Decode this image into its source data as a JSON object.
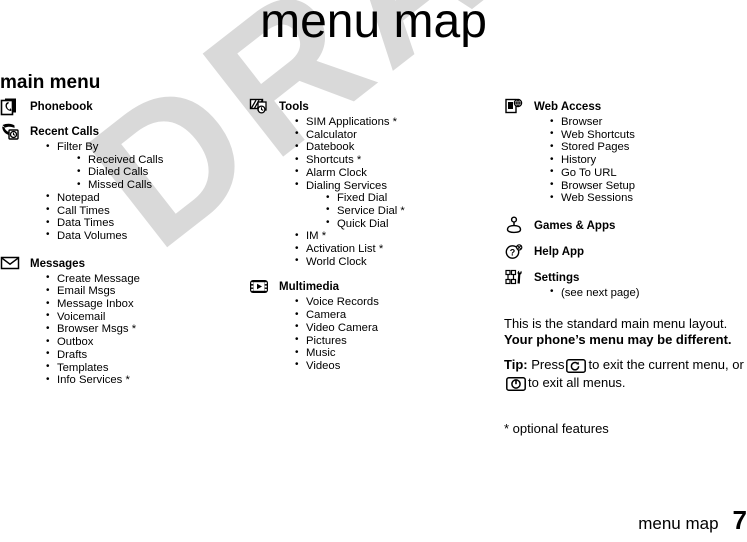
{
  "page": {
    "title": "menu map",
    "section_heading": "main menu",
    "footer_label": "menu map",
    "footer_page_number": "7",
    "watermark_text": "DRAFT",
    "watermark_color": "#d9d9d9",
    "text_color": "#000000",
    "background_color": "#ffffff"
  },
  "columns": [
    {
      "id": "column-1",
      "groups": [
        {
          "label": "Phonebook",
          "icon": "phonebook-icon",
          "items": []
        },
        {
          "label": "Recent Calls",
          "icon": "recent-calls-icon",
          "items": [
            {
              "label": "Filter By",
              "subitems": [
                {
                  "label": "Received Calls"
                },
                {
                  "label": "Dialed Calls"
                },
                {
                  "label": "Missed Calls"
                }
              ]
            },
            {
              "label": "Notepad"
            },
            {
              "label": "Call Times"
            },
            {
              "label": "Data Times"
            },
            {
              "label": "Data Volumes"
            }
          ]
        },
        {
          "label": "Messages",
          "icon": "messages-envelope-icon",
          "items": [
            {
              "label": "Create Message"
            },
            {
              "label": "Email Msgs"
            },
            {
              "label": "Message Inbox"
            },
            {
              "label": "Voicemail"
            },
            {
              "label": "Browser Msgs *"
            },
            {
              "label": "Outbox"
            },
            {
              "label": "Drafts"
            },
            {
              "label": "Templates"
            },
            {
              "label": "Info Services *"
            }
          ]
        }
      ]
    },
    {
      "id": "column-2",
      "groups": [
        {
          "label": "Tools",
          "icon": "tools-icon",
          "items": [
            {
              "label": "SIM Applications *"
            },
            {
              "label": "Calculator"
            },
            {
              "label": "Datebook"
            },
            {
              "label": "Shortcuts *"
            },
            {
              "label": "Alarm Clock"
            },
            {
              "label": "Dialing Services",
              "subitems": [
                {
                  "label": "Fixed Dial"
                },
                {
                  "label": "Service Dial *"
                },
                {
                  "label": "Quick Dial"
                }
              ]
            },
            {
              "label": "IM *"
            },
            {
              "label": "Activation List *"
            },
            {
              "label": "World Clock"
            }
          ]
        },
        {
          "label": "Multimedia",
          "icon": "multimedia-filmstrip-icon",
          "items": [
            {
              "label": "Voice Records"
            },
            {
              "label": "Camera"
            },
            {
              "label": "Video Camera"
            },
            {
              "label": "Pictures"
            },
            {
              "label": "Music"
            },
            {
              "label": "Videos"
            }
          ]
        }
      ]
    },
    {
      "id": "column-3",
      "groups": [
        {
          "label": "Web Access",
          "icon": "web-access-icon",
          "items": [
            {
              "label": "Browser"
            },
            {
              "label": "Web Shortcuts"
            },
            {
              "label": "Stored Pages"
            },
            {
              "label": "History"
            },
            {
              "label": "Go To URL"
            },
            {
              "label": "Browser Setup"
            },
            {
              "label": "Web Sessions"
            }
          ]
        },
        {
          "label": "Games & Apps",
          "icon": "joystick-icon",
          "items": []
        },
        {
          "label": "Help App",
          "icon": "help-question-icon",
          "items": []
        },
        {
          "label": "Settings",
          "icon": "settings-wrench-icon",
          "items": [
            {
              "label": "(see next page)"
            }
          ]
        }
      ]
    }
  ],
  "notes": {
    "line1": "This is the standard main menu layout.",
    "line2": "Your phone’s menu may be different.",
    "tip_label": "Tip:",
    "tip_part1": "Press",
    "tip_part2": "to exit the current menu, or",
    "tip_part3": "to exit all menus.",
    "tip_key1_icon": "back-key-icon",
    "tip_key2_icon": "power-end-key-icon",
    "optional_features": "* optional features"
  }
}
